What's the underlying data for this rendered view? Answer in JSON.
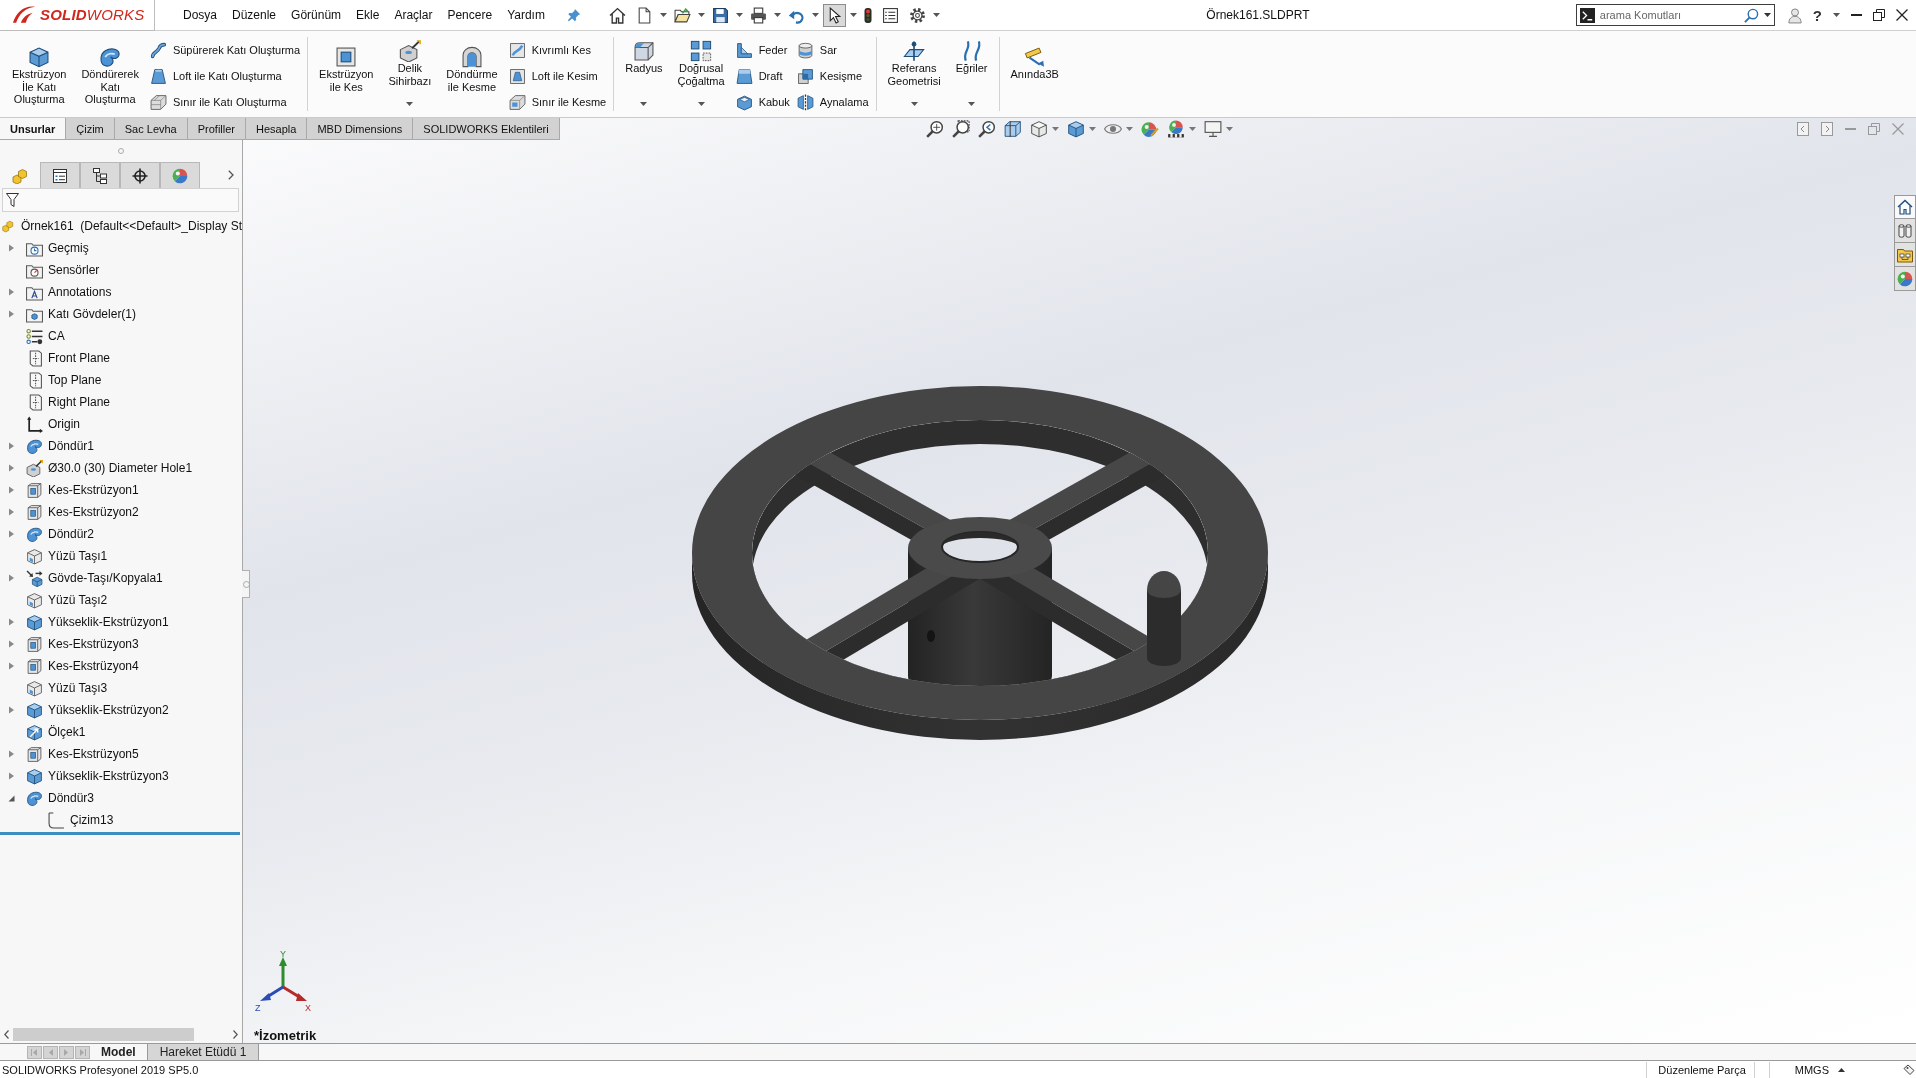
{
  "app": {
    "logo": "**SOLID**WORKS",
    "menu": [
      "Dosya",
      "Düzenle",
      "Görünüm",
      "Ekle",
      "Araçlar",
      "Pencere",
      "Yardım"
    ],
    "document_title": "Örnek161.SLDPRT",
    "search": {
      "placeholder": "arama Komutları"
    },
    "help": "?"
  },
  "quick_access": [
    {
      "pressed": false
    },
    {
      "pressed": false
    },
    {
      "pressed": false
    },
    {
      "pressed": false
    },
    {
      "pressed": false
    },
    {
      "pressed": false
    },
    {
      "pressed": true
    },
    {
      "pressed": false
    },
    {
      "pressed": false
    },
    {
      "pressed": false
    }
  ],
  "ribbon": {
    "groups": [
      [
        {
          "kind": "large",
          "label": "Ekstrüzyon\nİle Katı\nOluşturma",
          "dropdown": false
        },
        {
          "kind": "large",
          "label": "Döndürerek\nKatı\nOluşturma",
          "dropdown": false
        },
        {
          "kind": "column",
          "items": [
            "Süpürerek Katı Oluşturma",
            "Loft ile Katı Oluşturma",
            "Sınır ile Katı Oluşturma"
          ]
        }
      ],
      [
        {
          "kind": "large",
          "label": "Ekstrüzyon\nile Kes",
          "dropdown": false
        },
        {
          "kind": "large",
          "label": "Delik\nSihirbazı",
          "dropdown": true
        },
        {
          "kind": "large",
          "label": "Döndürme\nile Kesme",
          "dropdown": false
        },
        {
          "kind": "column",
          "items": [
            "Kıvrımlı Kes",
            "Loft ile Kesim",
            "Sınır ile Kesme"
          ]
        }
      ],
      [
        {
          "kind": "large",
          "label": "Radyus",
          "dropdown": true
        },
        {
          "kind": "large",
          "label": "Doğrusal\nÇoğaltma",
          "dropdown": true
        },
        {
          "kind": "column",
          "items": [
            "Feder",
            "Draft",
            "Kabuk"
          ]
        },
        {
          "kind": "column",
          "items": [
            "Sar",
            "Kesişme",
            "Aynalama"
          ]
        }
      ],
      [
        {
          "kind": "large",
          "label": "Referans\nGeometrisi",
          "dropdown": true
        },
        {
          "kind": "large",
          "label": "Eğriler",
          "dropdown": true
        }
      ],
      [
        {
          "kind": "large",
          "label": "Anında3B",
          "dropdown": false
        }
      ]
    ]
  },
  "command_tabs": [
    {
      "label": "Unsurlar",
      "selected": true
    },
    {
      "label": "Çizim",
      "selected": false
    },
    {
      "label": "Sac Levha",
      "selected": false
    },
    {
      "label": "Profiller",
      "selected": false
    },
    {
      "label": "Hesapla",
      "selected": false
    },
    {
      "label": "MBD Dimensions",
      "selected": false
    },
    {
      "label": "SOLIDWORKS Eklentileri",
      "selected": false
    }
  ],
  "feature_manager": {
    "tabs": [
      {
        "selected": true
      },
      {
        "selected": false
      },
      {
        "selected": false
      },
      {
        "selected": false
      },
      {
        "selected": false
      }
    ],
    "root": "Örnek161  (Default<<Default>_Display St",
    "items": [
      {
        "label": "Geçmiş",
        "kind": "history",
        "expanded": false
      },
      {
        "label": "Sensörler",
        "kind": "sensors"
      },
      {
        "label": "Annotations",
        "kind": "annotations",
        "expanded": false
      },
      {
        "label": "Katı Gövdeler(1)",
        "kind": "bodies",
        "expanded": false
      },
      {
        "label": "CA",
        "kind": "equations"
      },
      {
        "label": "Front Plane",
        "kind": "plane"
      },
      {
        "label": "Top Plane",
        "kind": "plane"
      },
      {
        "label": "Right Plane",
        "kind": "plane"
      },
      {
        "label": "Origin",
        "kind": "origin"
      },
      {
        "label": "Döndür1",
        "kind": "revolve",
        "expanded": false
      },
      {
        "label": "Ø30.0 (30) Diameter Hole1",
        "kind": "hole",
        "expanded": false
      },
      {
        "label": "Kes-Ekstrüzyon1",
        "kind": "cut",
        "expanded": false
      },
      {
        "label": "Kes-Ekstrüzyon2",
        "kind": "cut",
        "expanded": false
      },
      {
        "label": "Döndür2",
        "kind": "revolve",
        "expanded": false
      },
      {
        "label": "Yüzü Taşı1",
        "kind": "move-face"
      },
      {
        "label": "Gövde-Taşı/Kopyala1",
        "kind": "move-copy",
        "expanded": false
      },
      {
        "label": "Yüzü Taşı2",
        "kind": "move-face"
      },
      {
        "label": "Yükseklik-Ekstrüzyon1",
        "kind": "extrude",
        "expanded": false
      },
      {
        "label": "Kes-Ekstrüzyon3",
        "kind": "cut",
        "expanded": false
      },
      {
        "label": "Kes-Ekstrüzyon4",
        "kind": "cut",
        "expanded": false
      },
      {
        "label": "Yüzü Taşı3",
        "kind": "move-face"
      },
      {
        "label": "Yükseklik-Ekstrüzyon2",
        "kind": "extrude",
        "expanded": false
      },
      {
        "label": "Ölçek1",
        "kind": "scale"
      },
      {
        "label": "Kes-Ekstrüzyon5",
        "kind": "cut",
        "expanded": false
      },
      {
        "label": "Yükseklik-Ekstrüzyon3",
        "kind": "extrude",
        "expanded": false
      },
      {
        "label": "Döndür3",
        "kind": "revolve",
        "expanded": true,
        "children": [
          {
            "label": "Çizim13",
            "kind": "sketch"
          }
        ]
      }
    ]
  },
  "viewport": {
    "view_name": "*İzometrik",
    "triad": [
      "Y",
      "X",
      "Z"
    ]
  },
  "task_pane_tabs": [
    {
      "selected": true
    },
    {
      "selected": false
    },
    {
      "selected": false
    },
    {
      "selected": false
    }
  ],
  "bottom_tabs": [
    {
      "label": "Model",
      "selected": true
    },
    {
      "label": "Hareket Etüdü 1",
      "selected": false
    }
  ],
  "status_bar": {
    "product": "SOLIDWORKS Profesyonel 2019 SP5.0",
    "mode": "Düzenleme Parça",
    "units": "MMGS"
  }
}
